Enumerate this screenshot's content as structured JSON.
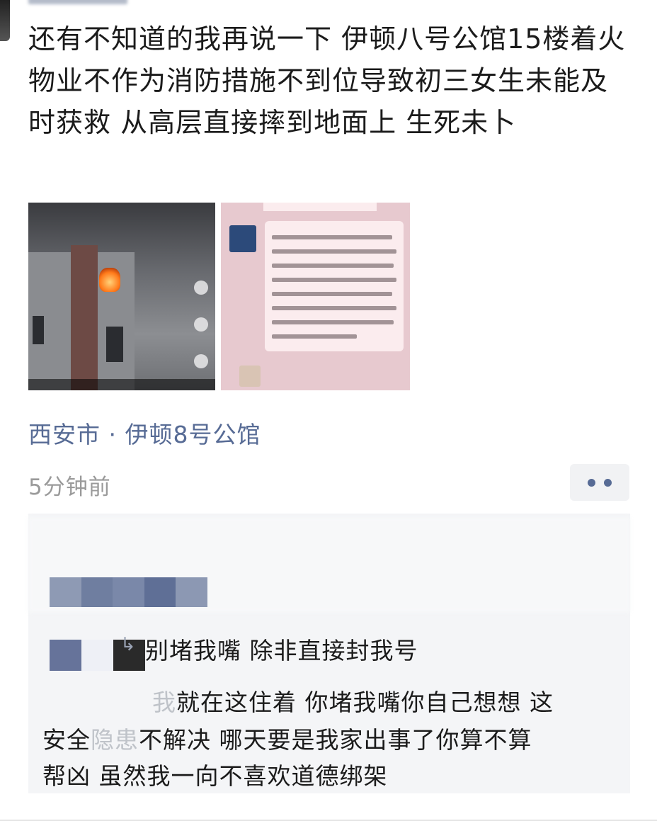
{
  "post": {
    "text": "还有不知道的我再说一下 伊顿八号公馆15楼着火 物业不作为消防措施不到位导致初三女生未能及时获救 从高层直接摔到地面上 生死未卜",
    "location": "西安市 · 伊顿8号公馆",
    "timestamp": "5分钟前",
    "images": [
      "fire-building-photo",
      "chat-screenshot-photo"
    ]
  },
  "comments": {
    "reply_text": "别堵我嘴 除非直接封我号",
    "body_line1_faded": "我",
    "body_line1": "就在这住着 你堵我嘴你自己想想 这",
    "body_line2_a": "安全",
    "body_line2_faded": "隐患",
    "body_line2_b": "不解决 哪天要是我家出事了你算不算",
    "body_line3": "帮凶 虽然我一向不喜欢道德绑架"
  },
  "colors": {
    "link": "#576b95",
    "meta": "#9a9a9a",
    "comment_bg": "#f4f5f7"
  },
  "icons": [
    "more-options-icon",
    "reply-arrow-icon"
  ]
}
